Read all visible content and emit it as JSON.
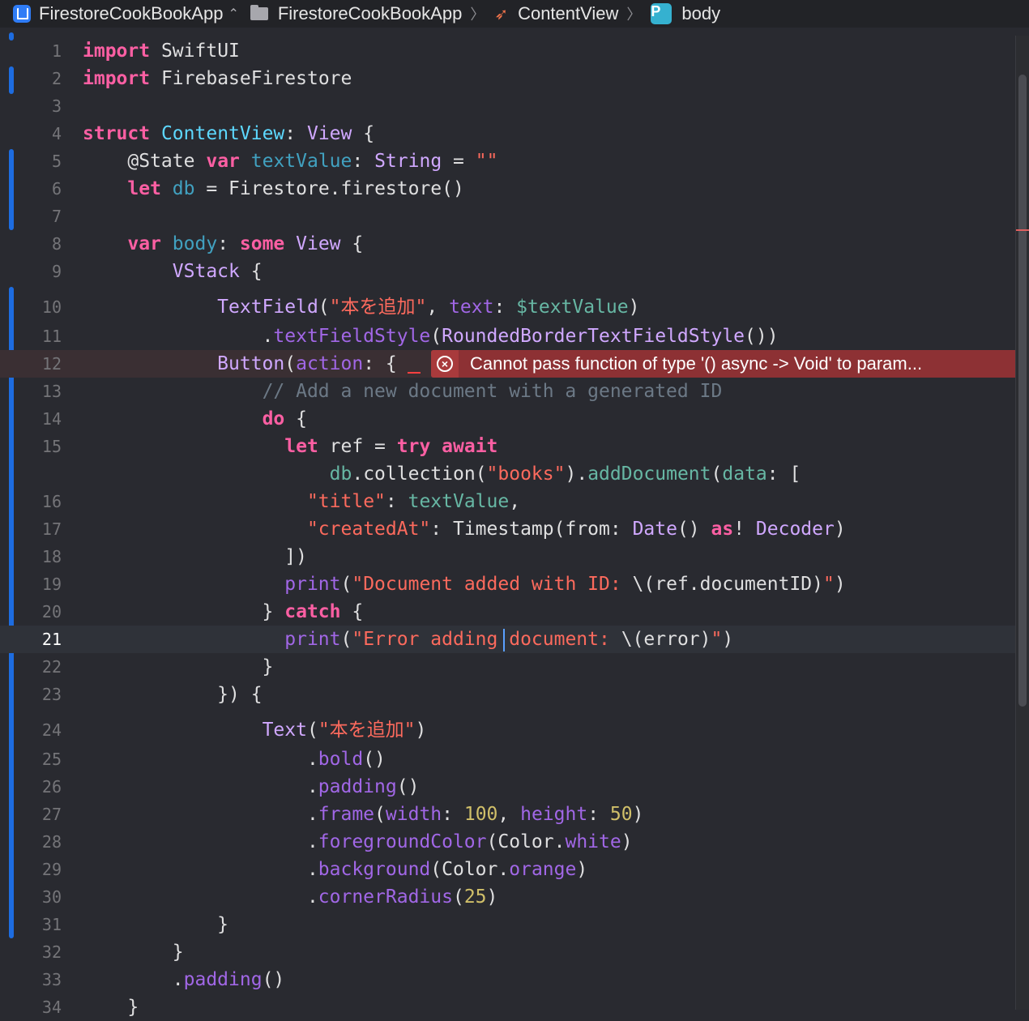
{
  "jumpbar": {
    "scheme": "FirestoreCookBookApp",
    "project": "FirestoreCookBookApp",
    "file": "ContentView",
    "symbol_badge": "P",
    "symbol": "body"
  },
  "editor": {
    "current_line": 21,
    "lines": [
      {
        "n": "1"
      },
      {
        "n": "2"
      },
      {
        "n": "3"
      },
      {
        "n": "4"
      },
      {
        "n": "5"
      },
      {
        "n": "6"
      },
      {
        "n": "7"
      },
      {
        "n": "8"
      },
      {
        "n": "9"
      },
      {
        "n": "10"
      },
      {
        "n": "11"
      },
      {
        "n": "12"
      },
      {
        "n": "13"
      },
      {
        "n": "14"
      },
      {
        "n": "15"
      },
      {
        "n": ""
      },
      {
        "n": "16"
      },
      {
        "n": "17"
      },
      {
        "n": "18"
      },
      {
        "n": "19"
      },
      {
        "n": "20"
      },
      {
        "n": "21"
      },
      {
        "n": "22"
      },
      {
        "n": "23"
      },
      {
        "n": "24"
      },
      {
        "n": "25"
      },
      {
        "n": "26"
      },
      {
        "n": "27"
      },
      {
        "n": "28"
      },
      {
        "n": "29"
      },
      {
        "n": "30"
      },
      {
        "n": "31"
      },
      {
        "n": "32"
      },
      {
        "n": "33"
      },
      {
        "n": "34"
      }
    ],
    "tokens": {
      "import": "import",
      "SwiftUI": "SwiftUI",
      "FirebaseFirestore": "FirebaseFirestore",
      "struct": "struct",
      "ContentView": "ContentView",
      "View": "View",
      "State": "@State",
      "var": "var",
      "textValue": "textValue",
      "String": "String",
      "emptyStr": "\"\"",
      "let": "let",
      "db": "db",
      "Firestore": "Firestore",
      "firestore": "firestore",
      "body": "body",
      "some": "some",
      "VStack": "VStack",
      "TextField": "TextField",
      "tf_label": "\"本を追加\"",
      "text": "text",
      "bindTextValue": "$textValue",
      "textFieldStyle": "textFieldStyle",
      "RoundedBorderTextFieldStyle": "RoundedBorderTextFieldStyle",
      "Button": "Button",
      "action": "action",
      "comment": "// Add a new document with a generated ID",
      "do": "do",
      "ref": "ref",
      "try": "try",
      "await": "await",
      "collection": "collection",
      "books": "\"books\"",
      "addDocument": "addDocument",
      "data": "data",
      "title": "\"title\"",
      "createdAt": "\"createdAt\"",
      "Timestamp": "Timestamp",
      "from": "from",
      "Date": "Date",
      "as": "as",
      "Decoder": "Decoder",
      "print": "print",
      "str19a": "\"Document added with ID: ",
      "documentID": "documentID",
      "str19b": "\"",
      "catch": "catch",
      "str21a": "\"Error adding document: ",
      "error": "error",
      "str21b": "\"",
      "Text": "Text",
      "text_label": "\"本を追加\"",
      "bold": "bold",
      "padding": "padding",
      "frame": "frame",
      "width": "width",
      "w100": "100",
      "height": "height",
      "h50": "50",
      "foregroundColor": "foregroundColor",
      "Color": "Color",
      "white": "white",
      "background": "background",
      "orange": "orange",
      "cornerRadius": "cornerRadius",
      "r25": "25"
    }
  },
  "error": {
    "message": "Cannot pass function of type '() async -> Void' to param..."
  },
  "colors": {
    "background": "#292a30",
    "keyword": "#fc5fa3",
    "string": "#fc6a5d",
    "error_banner": "#8d3134",
    "change_bar": "#1d6ce0"
  }
}
